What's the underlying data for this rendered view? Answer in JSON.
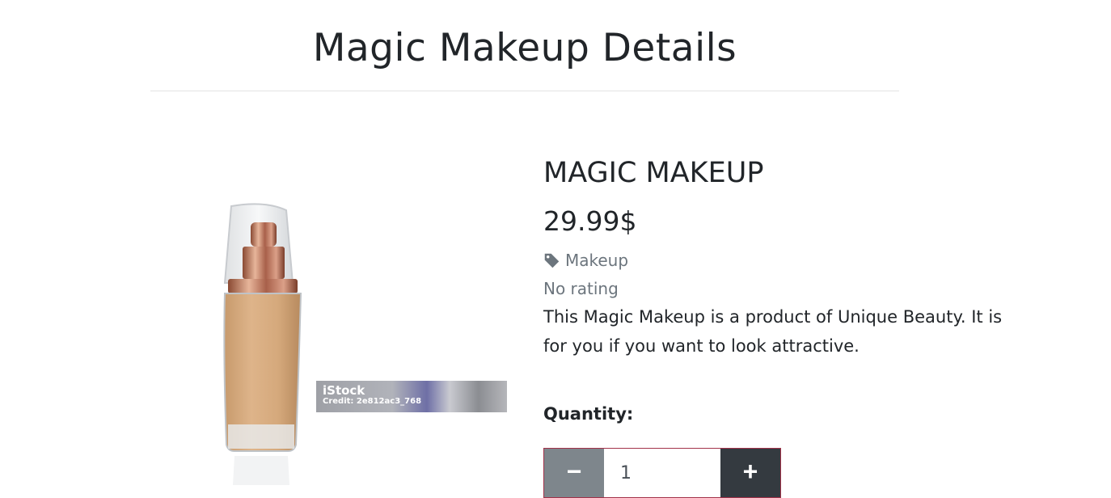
{
  "page": {
    "title": "Magic Makeup Details"
  },
  "product": {
    "name": "MAGIC MAKEUP",
    "price": "29.99$",
    "category": "Makeup",
    "category_icon": "tag-icon",
    "rating": "No rating",
    "description": "This Magic Makeup is a product of Unique Beauty. It is for you if you want to look attractive."
  },
  "image": {
    "watermark_brand": "iStock",
    "watermark_credit": "Credit: 2e812ac3_768"
  },
  "quantity": {
    "label": "Quantity:",
    "value": "1",
    "minus_label": "−",
    "plus_label": "+"
  },
  "colors": {
    "text": "#212529",
    "muted": "#6c757d",
    "minus_button": "#7e868c",
    "plus_button": "#343a40",
    "quantity_border": "#a3324a"
  }
}
